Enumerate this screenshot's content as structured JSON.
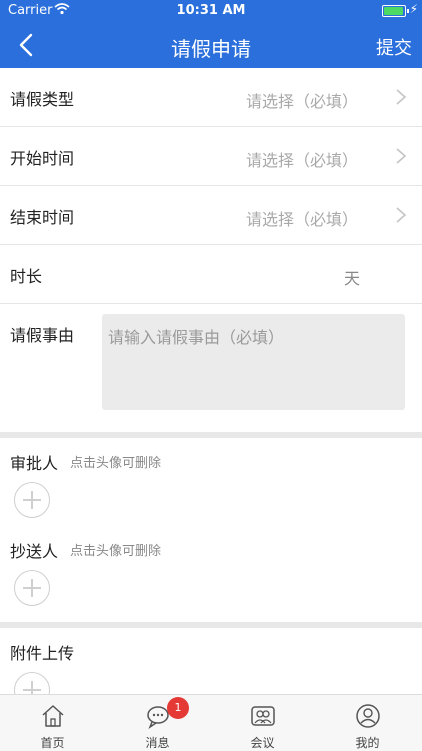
{
  "status_bar": {
    "carrier": "Carrier",
    "time": "10:31 AM",
    "battery_level": 1.0
  },
  "nav": {
    "title": "请假申请",
    "submit_label": "提交"
  },
  "form": {
    "leave_type": {
      "label": "请假类型",
      "placeholder": "请选择（必填）"
    },
    "start_time": {
      "label": "开始时间",
      "placeholder": "请选择（必填）"
    },
    "end_time": {
      "label": "结束时间",
      "placeholder": "请选择（必填）"
    },
    "duration": {
      "label": "时长",
      "unit": "天"
    },
    "reason": {
      "label": "请假事由",
      "placeholder": "请输入请假事由（必填）"
    }
  },
  "approvers": {
    "title": "审批人",
    "hint": "点击头像可删除"
  },
  "cc": {
    "title": "抄送人",
    "hint": "点击头像可删除"
  },
  "attachments": {
    "title": "附件上传"
  },
  "tabbar": {
    "items": [
      {
        "label": "首页",
        "icon": "home-icon"
      },
      {
        "label": "消息",
        "icon": "chat-icon",
        "badge": "1"
      },
      {
        "label": "会议",
        "icon": "meeting-icon"
      },
      {
        "label": "我的",
        "icon": "profile-icon"
      }
    ]
  },
  "colors": {
    "brand": "#2a6fdb",
    "badge": "#e53935"
  }
}
